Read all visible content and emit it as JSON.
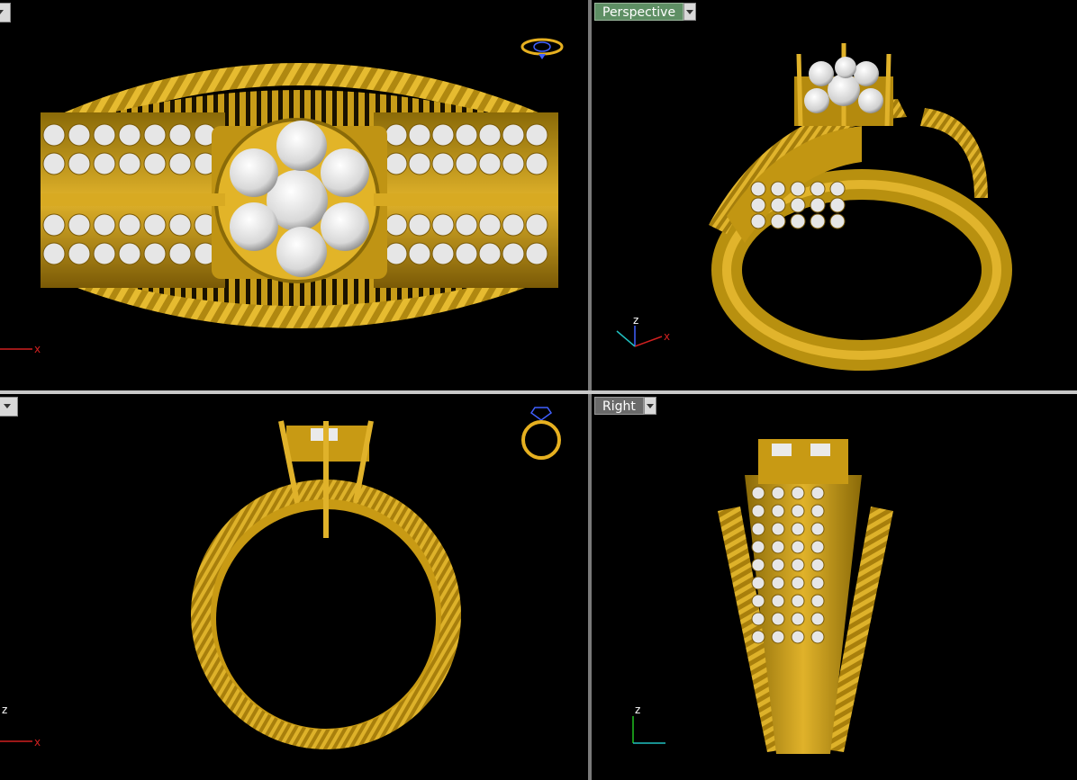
{
  "viewports": {
    "top_left": {
      "label": ""
    },
    "top_right": {
      "label": "Perspective"
    },
    "bottom_left": {
      "label": ""
    },
    "bottom_right": {
      "label": "Right"
    }
  },
  "axes": {
    "x": "x",
    "z": "z"
  },
  "colors": {
    "gold": "#c9a016",
    "gold_dark": "#6e5205",
    "gold_light": "#f0c640",
    "stone": "#e8e8e8",
    "axis_x": "#d02020",
    "axis_y": "#20c020",
    "axis_z": "#4060ff",
    "tab_active": "#5e8f64"
  }
}
